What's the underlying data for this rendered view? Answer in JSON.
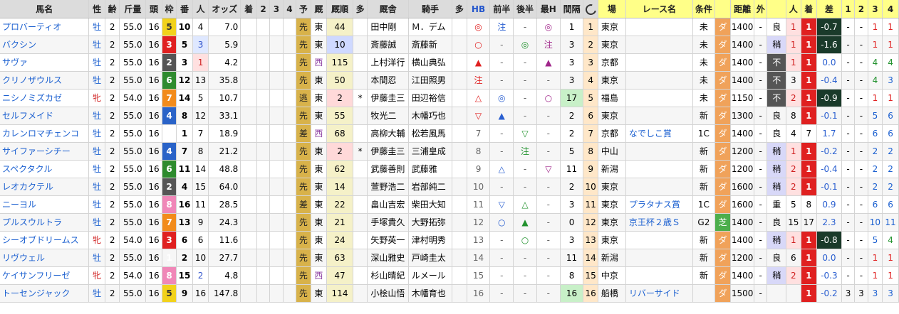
{
  "headers": [
    "馬名",
    "性",
    "齢",
    "斤量",
    "頭",
    "枠",
    "番",
    "人",
    "オッズ",
    "着",
    "2",
    "3",
    "4",
    "予",
    "厩",
    "厩順",
    "多",
    "厩舎",
    "騎手",
    "多",
    "HB",
    "前半",
    "後半",
    "最H",
    "間隔",
    "refresh-icon",
    "場",
    "レース名",
    "条件",
    "",
    "距離",
    "外",
    "",
    "人",
    "着",
    "差",
    "1",
    "2",
    "3",
    "4"
  ],
  "rows": [
    {
      "name": "プロバーティオ",
      "sex": "牡",
      "age": "2",
      "kin": "55.0",
      "tou": "16",
      "waku": "5",
      "ban": "10",
      "pop": "4",
      "odds": "7.0",
      "yoso": "先",
      "ew": "東",
      "rank": "44",
      "multi": "",
      "stable": "田中剛",
      "jockey": "Ｍ．デム",
      "multi2": "",
      "hb": "◎",
      "zen": "注",
      "kou": "-",
      "saih": "◎",
      "kankaku": "1",
      "idx": "1",
      "ba": "東京",
      "race": "",
      "cond": "未",
      "surf": "ダ",
      "dist": "1400",
      "out": "-",
      "state": "良",
      "pp": "1",
      "chaku": "1",
      "sa": "-0.7",
      "r1": "-",
      "r2": "-",
      "r3": "1",
      "r4": "1"
    },
    {
      "name": "バクシン",
      "sex": "牡",
      "age": "2",
      "kin": "55.0",
      "tou": "16",
      "waku": "3",
      "ban": "5",
      "pop": "3",
      "odds": "5.9",
      "yoso": "先",
      "ew": "東",
      "rank": "10",
      "multi": "",
      "stable": "斎藤誠",
      "jockey": "斎藤新",
      "multi2": "",
      "hb": "○",
      "zen": "-",
      "kou": "◎",
      "saih": "注",
      "kankaku": "3",
      "idx": "2",
      "ba": "東京",
      "race": "",
      "cond": "未",
      "surf": "ダ",
      "dist": "1400",
      "out": "-",
      "state": "稍",
      "pp": "1",
      "chaku": "1",
      "sa": "-1.6",
      "r1": "-",
      "r2": "-",
      "r3": "1",
      "r4": "1"
    },
    {
      "name": "サヴァ",
      "sex": "牡",
      "age": "2",
      "kin": "55.0",
      "tou": "16",
      "waku": "2",
      "ban": "3",
      "pop": "1",
      "odds": "4.2",
      "yoso": "先",
      "ew": "西",
      "rank": "115",
      "multi": "",
      "stable": "上村洋行",
      "jockey": "横山典弘",
      "multi2": "",
      "hb": "▲",
      "zen": "-",
      "kou": "-",
      "saih": "▲",
      "kankaku": "3",
      "idx": "3",
      "ba": "京都",
      "race": "",
      "cond": "未",
      "surf": "ダ",
      "dist": "1400",
      "out": "-",
      "state": "不",
      "pp": "1",
      "chaku": "1",
      "sa": "0.0",
      "r1": "-",
      "r2": "-",
      "r3": "4",
      "r4": "4"
    },
    {
      "name": "クリノザウルス",
      "sex": "牡",
      "age": "2",
      "kin": "55.0",
      "tou": "16",
      "waku": "6",
      "ban": "12",
      "pop": "13",
      "odds": "35.8",
      "yoso": "先",
      "ew": "東",
      "rank": "50",
      "multi": "",
      "stable": "本間忍",
      "jockey": "江田照男",
      "multi2": "",
      "hb": "注",
      "zen": "-",
      "kou": "-",
      "saih": "-",
      "kankaku": "3",
      "idx": "4",
      "ba": "東京",
      "race": "",
      "cond": "未",
      "surf": "ダ",
      "dist": "1400",
      "out": "-",
      "state": "不",
      "pp": "3",
      "chaku": "1",
      "sa": "-0.4",
      "r1": "-",
      "r2": "-",
      "r3": "4",
      "r4": "3"
    },
    {
      "name": "ニシノミズカゼ",
      "sex": "牝",
      "age": "2",
      "kin": "54.0",
      "tou": "16",
      "waku": "7",
      "ban": "14",
      "pop": "5",
      "odds": "10.7",
      "yoso": "逃",
      "ew": "東",
      "rank": "2",
      "multi": "*",
      "stable": "伊藤圭三",
      "jockey": "田辺裕信",
      "multi2": "",
      "hb": "△",
      "zen": "◎",
      "kou": "-",
      "saih": "○",
      "kankaku": "17",
      "idx": "5",
      "ba": "福島",
      "race": "",
      "cond": "未",
      "surf": "ダ",
      "dist": "1150",
      "out": "-",
      "state": "不",
      "pp": "2",
      "chaku": "1",
      "sa": "-0.9",
      "r1": "-",
      "r2": "-",
      "r3": "1",
      "r4": "1"
    },
    {
      "name": "セルフメイド",
      "sex": "牡",
      "age": "2",
      "kin": "55.0",
      "tou": "16",
      "waku": "4",
      "ban": "8",
      "pop": "12",
      "odds": "33.1",
      "yoso": "先",
      "ew": "東",
      "rank": "55",
      "multi": "",
      "stable": "牧光二",
      "jockey": "木幡巧也",
      "multi2": "",
      "hb": "▽",
      "zen": "▲",
      "kou": "-",
      "saih": "-",
      "kankaku": "2",
      "idx": "6",
      "ba": "東京",
      "race": "",
      "cond": "新",
      "surf": "ダ",
      "dist": "1300",
      "out": "-",
      "state": "良",
      "pp": "8",
      "chaku": "1",
      "sa": "-0.1",
      "r1": "-",
      "r2": "-",
      "r3": "5",
      "r4": "6"
    },
    {
      "name": "カレンロマチェンコ",
      "sex": "牡",
      "age": "2",
      "kin": "55.0",
      "tou": "16",
      "waku": "1",
      "ban": "1",
      "pop": "7",
      "odds": "18.9",
      "yoso": "差",
      "ew": "西",
      "rank": "68",
      "multi": "",
      "stable": "高柳大輔",
      "jockey": "松若風馬",
      "multi2": "",
      "hb": "7",
      "zen": "-",
      "kou": "▽",
      "saih": "-",
      "kankaku": "2",
      "idx": "7",
      "ba": "京都",
      "race": "なでしこ賞",
      "cond": "1C",
      "surf": "ダ",
      "dist": "1400",
      "out": "-",
      "state": "良",
      "pp": "4",
      "chaku": "7",
      "sa": "1.7",
      "r1": "-",
      "r2": "-",
      "r3": "6",
      "r4": "6"
    },
    {
      "name": "サイファーシチー",
      "sex": "牡",
      "age": "2",
      "kin": "55.0",
      "tou": "16",
      "waku": "4",
      "ban": "7",
      "pop": "8",
      "odds": "21.2",
      "yoso": "先",
      "ew": "東",
      "rank": "2",
      "multi": "*",
      "stable": "伊藤圭三",
      "jockey": "三浦皇成",
      "multi2": "",
      "hb": "8",
      "zen": "-",
      "kou": "注",
      "saih": "-",
      "kankaku": "5",
      "idx": "8",
      "ba": "中山",
      "race": "",
      "cond": "新",
      "surf": "ダ",
      "dist": "1200",
      "out": "-",
      "state": "稍",
      "pp": "1",
      "chaku": "1",
      "sa": "-0.2",
      "r1": "-",
      "r2": "-",
      "r3": "2",
      "r4": "2"
    },
    {
      "name": "スペクタクル",
      "sex": "牡",
      "age": "2",
      "kin": "55.0",
      "tou": "16",
      "waku": "6",
      "ban": "11",
      "pop": "14",
      "odds": "48.8",
      "yoso": "先",
      "ew": "東",
      "rank": "62",
      "multi": "",
      "stable": "武藤善則",
      "jockey": "武藤雅",
      "multi2": "",
      "hb": "9",
      "zen": "△",
      "kou": "-",
      "saih": "▽",
      "kankaku": "11",
      "idx": "9",
      "ba": "新潟",
      "race": "",
      "cond": "新",
      "surf": "ダ",
      "dist": "1200",
      "out": "-",
      "state": "稍",
      "pp": "2",
      "chaku": "1",
      "sa": "-0.4",
      "r1": "-",
      "r2": "-",
      "r3": "2",
      "r4": "2"
    },
    {
      "name": "レオカクテル",
      "sex": "牡",
      "age": "2",
      "kin": "55.0",
      "tou": "16",
      "waku": "2",
      "ban": "4",
      "pop": "15",
      "odds": "64.0",
      "yoso": "先",
      "ew": "東",
      "rank": "14",
      "multi": "",
      "stable": "萱野浩二",
      "jockey": "岩部純二",
      "multi2": "",
      "hb": "10",
      "zen": "-",
      "kou": "-",
      "saih": "-",
      "kankaku": "2",
      "idx": "10",
      "ba": "東京",
      "race": "",
      "cond": "新",
      "surf": "ダ",
      "dist": "1600",
      "out": "-",
      "state": "稍",
      "pp": "2",
      "chaku": "1",
      "sa": "-0.1",
      "r1": "-",
      "r2": "-",
      "r3": "2",
      "r4": "2"
    },
    {
      "name": "ニーヨル",
      "sex": "牡",
      "age": "2",
      "kin": "55.0",
      "tou": "16",
      "waku": "8",
      "ban": "16",
      "pop": "11",
      "odds": "28.5",
      "yoso": "差",
      "ew": "東",
      "rank": "22",
      "multi": "",
      "stable": "畠山吉宏",
      "jockey": "柴田大知",
      "multi2": "",
      "hb": "11",
      "zen": "▽",
      "kou": "△",
      "saih": "-",
      "kankaku": "3",
      "idx": "11",
      "ba": "東京",
      "race": "プラタナス賞",
      "cond": "1C",
      "surf": "ダ",
      "dist": "1600",
      "out": "-",
      "state": "重",
      "pp": "5",
      "chaku": "8",
      "sa": "0.9",
      "r1": "-",
      "r2": "-",
      "r3": "6",
      "r4": "6"
    },
    {
      "name": "プルスウルトラ",
      "sex": "牡",
      "age": "2",
      "kin": "55.0",
      "tou": "16",
      "waku": "7",
      "ban": "13",
      "pop": "9",
      "odds": "24.3",
      "yoso": "先",
      "ew": "東",
      "rank": "21",
      "multi": "",
      "stable": "手塚貴久",
      "jockey": "大野拓弥",
      "multi2": "",
      "hb": "12",
      "zen": "○",
      "kou": "▲",
      "saih": "-",
      "kankaku": "0",
      "idx": "12",
      "ba": "東京",
      "race": "京王杯２歳Ｓ",
      "cond": "G2",
      "surf": "芝",
      "dist": "1400",
      "out": "-",
      "state": "良",
      "pp": "15",
      "chaku": "17",
      "sa": "2.3",
      "r1": "-",
      "r2": "-",
      "r3": "10",
      "r4": "11"
    },
    {
      "name": "シーオブドリームス",
      "sex": "牝",
      "age": "2",
      "kin": "54.0",
      "tou": "16",
      "waku": "3",
      "ban": "6",
      "pop": "6",
      "odds": "11.6",
      "yoso": "先",
      "ew": "東",
      "rank": "24",
      "multi": "",
      "stable": "矢野英一",
      "jockey": "津村明秀",
      "multi2": "",
      "hb": "13",
      "zen": "-",
      "kou": "○",
      "saih": "-",
      "kankaku": "3",
      "idx": "13",
      "ba": "東京",
      "race": "",
      "cond": "新",
      "surf": "ダ",
      "dist": "1400",
      "out": "-",
      "state": "稍",
      "pp": "1",
      "chaku": "1",
      "sa": "-0.8",
      "r1": "-",
      "r2": "-",
      "r3": "5",
      "r4": "4"
    },
    {
      "name": "リヴウェル",
      "sex": "牡",
      "age": "2",
      "kin": "55.0",
      "tou": "16",
      "waku": "1",
      "ban": "2",
      "pop": "10",
      "odds": "27.7",
      "yoso": "先",
      "ew": "東",
      "rank": "63",
      "multi": "",
      "stable": "深山雅史",
      "jockey": "戸崎圭太",
      "multi2": "",
      "hb": "14",
      "zen": "-",
      "kou": "-",
      "saih": "-",
      "kankaku": "11",
      "idx": "14",
      "ba": "新潟",
      "race": "",
      "cond": "新",
      "surf": "ダ",
      "dist": "1200",
      "out": "-",
      "state": "良",
      "pp": "6",
      "chaku": "1",
      "sa": "0.0",
      "r1": "-",
      "r2": "-",
      "r3": "1",
      "r4": "1"
    },
    {
      "name": "ケイサンフリーゼ",
      "sex": "牝",
      "age": "2",
      "kin": "54.0",
      "tou": "16",
      "waku": "8",
      "ban": "15",
      "pop": "2",
      "odds": "4.8",
      "yoso": "先",
      "ew": "西",
      "rank": "47",
      "multi": "",
      "stable": "杉山晴紀",
      "jockey": "ルメール",
      "multi2": "",
      "hb": "15",
      "zen": "-",
      "kou": "-",
      "saih": "-",
      "kankaku": "8",
      "idx": "15",
      "ba": "中京",
      "race": "",
      "cond": "新",
      "surf": "ダ",
      "dist": "1400",
      "out": "-",
      "state": "稍",
      "pp": "2",
      "chaku": "1",
      "sa": "-0.3",
      "r1": "-",
      "r2": "-",
      "r3": "1",
      "r4": "1"
    },
    {
      "name": "トーセンジャック",
      "sex": "牡",
      "age": "2",
      "kin": "55.0",
      "tou": "16",
      "waku": "5",
      "ban": "9",
      "pop": "16",
      "odds": "147.8",
      "yoso": "先",
      "ew": "東",
      "rank": "114",
      "multi": "",
      "stable": "小桧山悟",
      "jockey": "木幡育也",
      "multi2": "",
      "hb": "16",
      "zen": "-",
      "kou": "-",
      "saih": "-",
      "kankaku": "16",
      "idx": "16",
      "ba": "船橋",
      "race": "リバーサイド",
      "cond": "",
      "surf": "ダ",
      "dist": "1500",
      "out": "-",
      "state": "",
      "pp": "",
      "chaku": "1",
      "sa": "-0.2",
      "r1": "3",
      "r2": "3",
      "r3": "3",
      "r4": "3"
    }
  ]
}
